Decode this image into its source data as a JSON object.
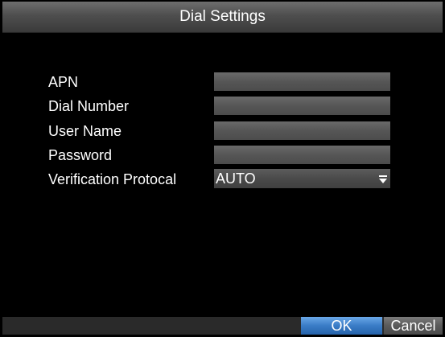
{
  "dialog": {
    "title": "Dial Settings"
  },
  "fields": {
    "apn": {
      "label": "APN",
      "value": ""
    },
    "dial_number": {
      "label": "Dial Number",
      "value": ""
    },
    "user_name": {
      "label": "User Name",
      "value": ""
    },
    "password": {
      "label": "Password",
      "value": ""
    },
    "verification_protocol": {
      "label": "Verification Protocal",
      "value": "AUTO"
    }
  },
  "buttons": {
    "ok_label": "OK",
    "cancel_label": "Cancel"
  },
  "icons": {
    "dropdown": "chevron-down-icon"
  },
  "colors": {
    "background": "#000000",
    "accent": "#3a7cc6"
  }
}
